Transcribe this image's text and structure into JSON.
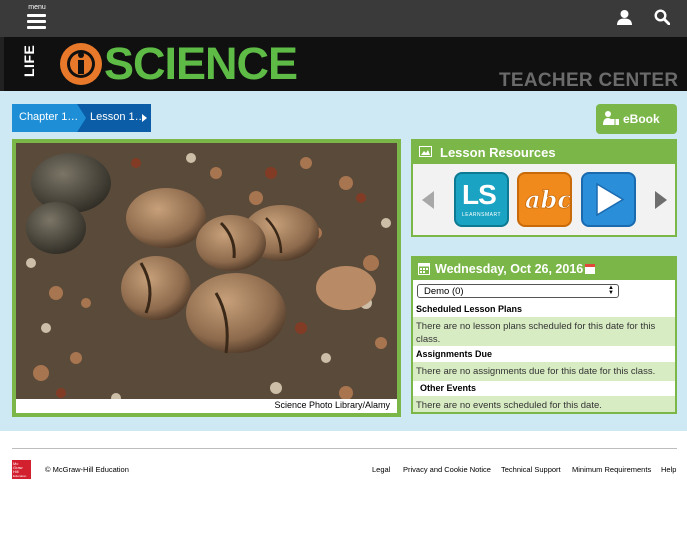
{
  "topbar": {
    "menu_label": "menu",
    "icons": [
      "user-icon",
      "search-icon"
    ]
  },
  "banner": {
    "life": "LIFE",
    "science": "SCIENCE",
    "teacher_center": "TEACHER CENTER"
  },
  "breadcrumb": [
    "Chapter 1…",
    "Lesson 1…"
  ],
  "ebook": {
    "label": "eBook"
  },
  "photo": {
    "caption": "Science Photo Library/Alamy"
  },
  "resources": {
    "title": "Lesson Resources",
    "tiles": [
      {
        "name": "learnsmart",
        "label": "LS",
        "sublabel": "LEARNSMART"
      },
      {
        "name": "vocabulary",
        "label": "abc"
      },
      {
        "name": "video",
        "label": ""
      }
    ]
  },
  "calendar": {
    "date": "Wednesday, Oct 26, 2016",
    "class_select": "Demo (0)",
    "sections": [
      {
        "title": "Scheduled Lesson Plans",
        "message": "There are no lesson plans scheduled for this date for this class."
      },
      {
        "title": "Assignments Due",
        "message": "There are no assignments due for this date for this class."
      },
      {
        "title": "Other Events",
        "message": "There are no events scheduled for this date."
      }
    ]
  },
  "footer": {
    "logo_text": [
      "Mc",
      "Graw",
      "Hill",
      "Education"
    ],
    "copyright": "© McGraw-Hill Education",
    "links": [
      "Legal",
      "Privacy and Cookie Notice",
      "Technical Support",
      "Minimum Requirements",
      "Help"
    ]
  },
  "colors": {
    "accent_green": "#7ab648",
    "crumb_blue": "#1e8fd6",
    "crumb_dark_blue": "#0a5da6",
    "content_bg": "#cfe9f4"
  }
}
